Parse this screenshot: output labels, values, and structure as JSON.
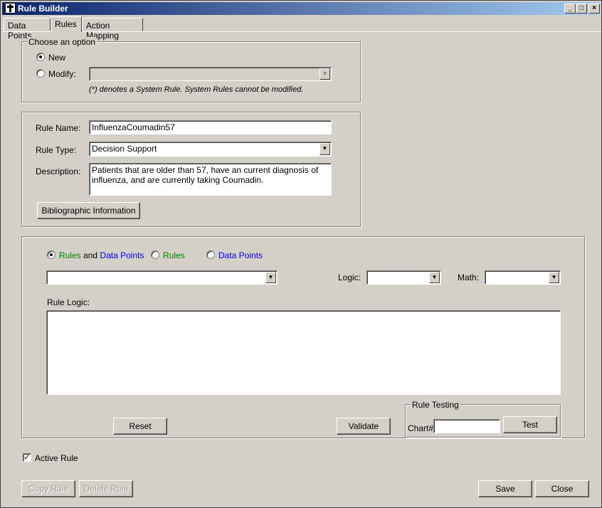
{
  "window": {
    "title": "Rule Builder",
    "min": "_",
    "max": "□",
    "close": "×"
  },
  "tabs": [
    {
      "label": "Data Points"
    },
    {
      "label": "Rules"
    },
    {
      "label": "Action Mapping"
    }
  ],
  "choose_option": {
    "legend": "Choose an option",
    "new_label": "New",
    "modify_label": "Modify:",
    "modify_value": "",
    "note": "(*) denotes a System Rule. System Rules cannot be modified."
  },
  "rule": {
    "name_label": "Rule Name:",
    "name_value": "InfluenzaCoumadin57",
    "type_label": "Rule Type:",
    "type_value": "Decision Support",
    "description_label": "Description:",
    "description_value": "Patients that are older than 57, have an current diagnosis of influenza, and are currently taking Coumadin.",
    "biblio_button": "Bibliographic Information"
  },
  "logic": {
    "radio_rules_and": "Rules",
    "radio_and_word": "and",
    "radio_data_points_and": "Data Points",
    "radio_rules": "Rules",
    "radio_data_points": "Data Points",
    "source_value": "",
    "logic_label": "Logic:",
    "logic_value": "",
    "math_label": "Math:",
    "math_value": "",
    "rule_logic_label": "Rule Logic:",
    "rule_logic_value": "",
    "reset_button": "Reset",
    "validate_button": "Validate"
  },
  "testing": {
    "legend": "Rule Testing",
    "chart_label": "Chart#",
    "chart_value": "",
    "test_button": "Test"
  },
  "footer": {
    "active_label": "Active Rule",
    "copy_button": "Copy Rule",
    "delete_button": "Delete Rule",
    "save_button": "Save",
    "close_button": "Close"
  },
  "colors": {
    "rules_text": "#008000",
    "data_points_text": "#0000ff",
    "titlebar": "#0a246a"
  }
}
